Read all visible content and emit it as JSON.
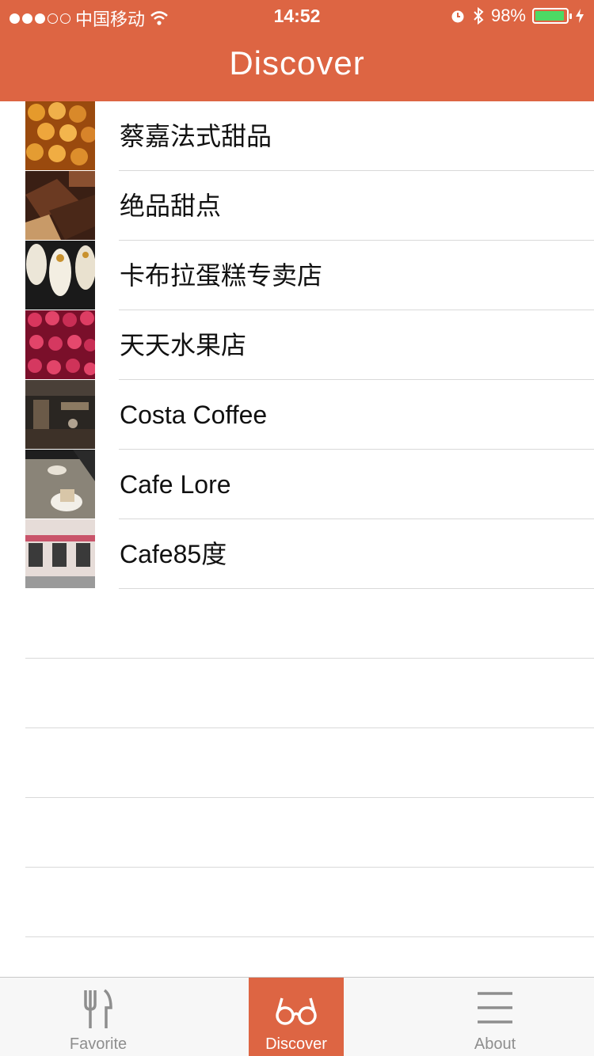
{
  "status_bar": {
    "carrier": "中国移动",
    "time": "14:52",
    "battery": "98%"
  },
  "header": {
    "title": "Discover"
  },
  "list": [
    {
      "label": "蔡嘉法式甜品",
      "image": "pastry-thumbnail"
    },
    {
      "label": "绝品甜点",
      "image": "chocolate-thumbnail"
    },
    {
      "label": "卡布拉蛋糕专卖店",
      "image": "cupcake-thumbnail"
    },
    {
      "label": "天天水果店",
      "image": "raspberry-thumbnail"
    },
    {
      "label": "Costa Coffee",
      "image": "coffee-shop-thumbnail"
    },
    {
      "label": "Cafe Lore",
      "image": "latte-thumbnail"
    },
    {
      "label": "Cafe85度",
      "image": "storefront-thumbnail"
    }
  ],
  "tabs": [
    {
      "label": "Favorite",
      "icon": "fork-knife-icon"
    },
    {
      "label": "Discover",
      "icon": "glasses-icon"
    },
    {
      "label": "About",
      "icon": "menu-icon"
    }
  ],
  "colors": {
    "accent": "#dd6543",
    "tab_inactive": "#8e8e8e",
    "separator": "#d9d9d9"
  }
}
